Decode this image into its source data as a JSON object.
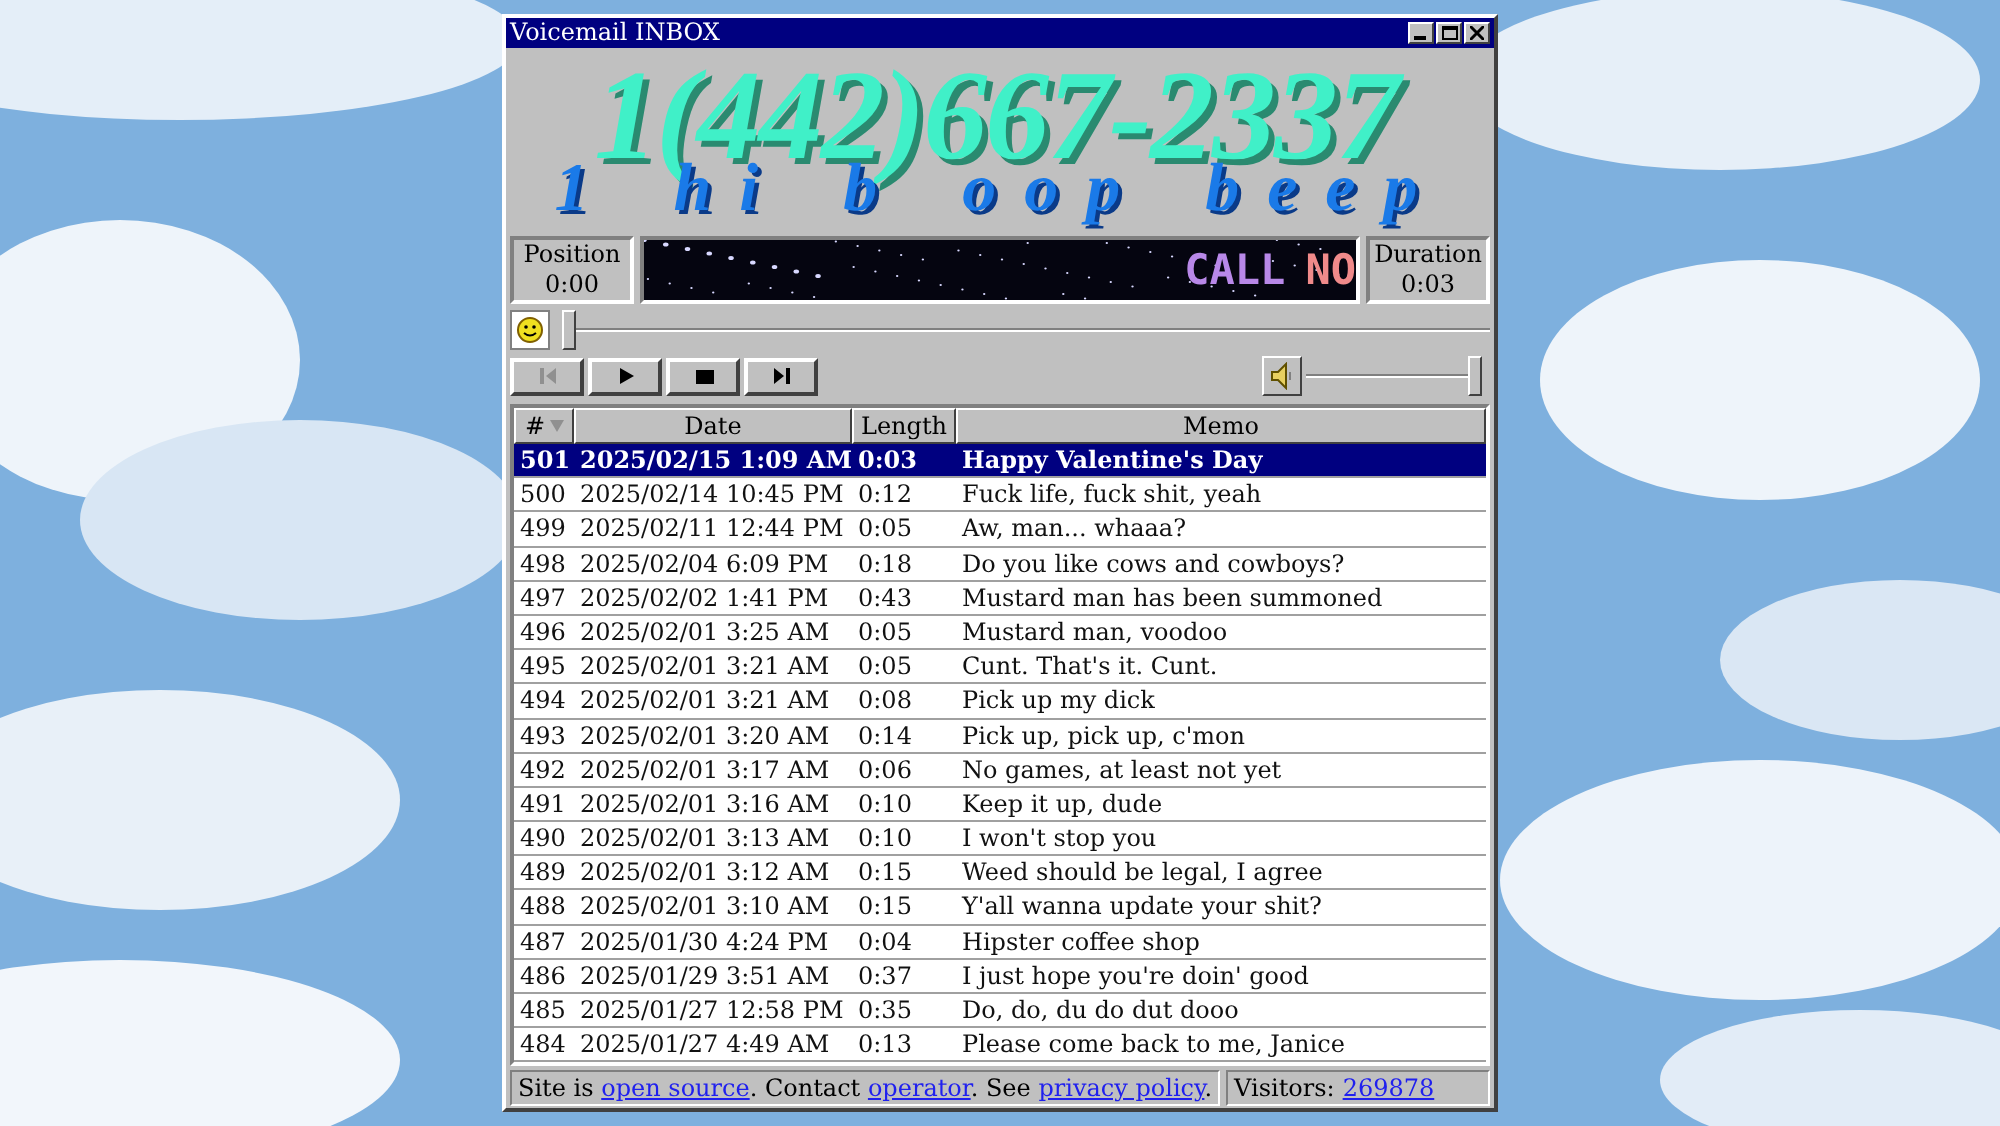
{
  "window": {
    "title": "Voicemail INBOX"
  },
  "phone": {
    "number": "1(442)667-2337",
    "mnemonic": "1 hi b oop beep"
  },
  "position": {
    "label": "Position",
    "value": "0:00"
  },
  "marquee": [
    {
      "text": "CALL",
      "color": "#b888e8"
    },
    {
      "text": "NO",
      "color": "#f08a8a"
    }
  ],
  "duration": {
    "label": "Duration",
    "value": "0:03"
  },
  "seek": {
    "level": 0
  },
  "controls": [
    {
      "kind": "previous",
      "disabled": true
    },
    {
      "kind": "play",
      "disabled": false
    },
    {
      "kind": "stop",
      "disabled": false
    },
    {
      "kind": "next",
      "disabled": false
    }
  ],
  "volume": {
    "level": 1
  },
  "table": {
    "columns": [
      {
        "label": "#",
        "sorted": true
      },
      {
        "label": "Date",
        "sorted": false
      },
      {
        "label": "Length",
        "sorted": false
      },
      {
        "label": "Memo",
        "sorted": false
      }
    ],
    "rows": [
      {
        "cells": [
          "501",
          "2025/02/15 1:09 AM",
          "0:03",
          "Happy Valentine's Day"
        ],
        "selected": true
      },
      {
        "cells": [
          "500",
          "2025/02/14 10:45 PM",
          "0:12",
          "Fuck life, fuck shit, yeah"
        ],
        "selected": false
      },
      {
        "cells": [
          "499",
          "2025/02/11 12:44 PM",
          "0:05",
          "Aw, man... whaaa?"
        ],
        "selected": false
      },
      {
        "cells": [
          "498",
          "2025/02/04 6:09 PM",
          "0:18",
          "Do you like cows and cowboys?"
        ],
        "selected": false
      },
      {
        "cells": [
          "497",
          "2025/02/02 1:41 PM",
          "0:43",
          "Mustard man has been summoned"
        ],
        "selected": false
      },
      {
        "cells": [
          "496",
          "2025/02/01 3:25 AM",
          "0:05",
          "Mustard man, voodoo"
        ],
        "selected": false
      },
      {
        "cells": [
          "495",
          "2025/02/01 3:21 AM",
          "0:05",
          "Cunt. That's it. Cunt."
        ],
        "selected": false
      },
      {
        "cells": [
          "494",
          "2025/02/01 3:21 AM",
          "0:08",
          "Pick up my dick"
        ],
        "selected": false
      },
      {
        "cells": [
          "493",
          "2025/02/01 3:20 AM",
          "0:14",
          "Pick up, pick up, c'mon"
        ],
        "selected": false
      },
      {
        "cells": [
          "492",
          "2025/02/01 3:17 AM",
          "0:06",
          "No games, at least not yet"
        ],
        "selected": false
      },
      {
        "cells": [
          "491",
          "2025/02/01 3:16 AM",
          "0:10",
          "Keep it up, dude"
        ],
        "selected": false
      },
      {
        "cells": [
          "490",
          "2025/02/01 3:13 AM",
          "0:10",
          "I won't stop you"
        ],
        "selected": false
      },
      {
        "cells": [
          "489",
          "2025/02/01 3:12 AM",
          "0:15",
          "Weed should be legal, I agree"
        ],
        "selected": false
      },
      {
        "cells": [
          "488",
          "2025/02/01 3:10 AM",
          "0:15",
          "Y'all wanna update your shit?"
        ],
        "selected": false
      },
      {
        "cells": [
          "487",
          "2025/01/30 4:24 PM",
          "0:04",
          "Hipster coffee shop"
        ],
        "selected": false
      },
      {
        "cells": [
          "486",
          "2025/01/29 3:51 AM",
          "0:37",
          "I just hope you're doin' good"
        ],
        "selected": false
      },
      {
        "cells": [
          "485",
          "2025/01/27 12:58 PM",
          "0:35",
          "Do, do, du do dut dooo"
        ],
        "selected": false
      },
      {
        "cells": [
          "484",
          "2025/01/27 4:49 AM",
          "0:13",
          "Please come back to me, Janice"
        ],
        "selected": false
      }
    ]
  },
  "status": {
    "notice": [
      {
        "kind": "text",
        "text": "Site is "
      },
      {
        "kind": "link",
        "text": "open source"
      },
      {
        "kind": "text",
        "text": ". Contact "
      },
      {
        "kind": "link",
        "text": "operator"
      },
      {
        "kind": "text",
        "text": ". See "
      },
      {
        "kind": "link",
        "text": "privacy policy"
      },
      {
        "kind": "text",
        "text": "."
      }
    ],
    "visitors_label": "Visitors:",
    "visitors_count": "269878"
  }
}
